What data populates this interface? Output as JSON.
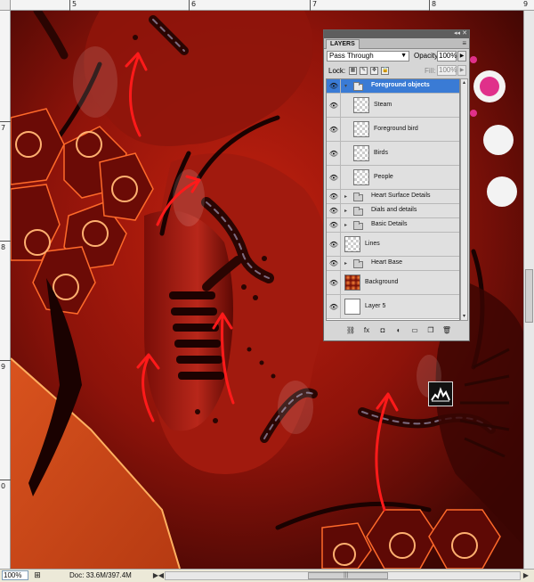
{
  "rulers": {
    "top_numbers": [
      "5",
      "6",
      "7",
      "8",
      "9"
    ],
    "left_numbers": [
      "7",
      "8",
      "9",
      "0"
    ]
  },
  "layers_panel": {
    "tab_label": "LAYERS",
    "minimize_glyph": "◂◂",
    "close_glyph": "✕",
    "menu_glyph": "≡",
    "blend_mode": "Pass Through",
    "opacity_label": "Opacity:",
    "opacity_value": "100%",
    "lock_label": "Lock:",
    "fill_label": "Fill:",
    "fill_value": "100%",
    "eye_glyph": "👁",
    "expanded_glyph": "▾",
    "collapsed_glyph": "▸",
    "scroll_up_glyph": "▴",
    "scroll_down_glyph": "▾",
    "lock_glyphs": [
      "▦",
      "✎",
      "✥",
      "🔒"
    ],
    "layers": [
      {
        "name": "Foreground objects",
        "kind": "group",
        "expanded": true,
        "selected": true
      },
      {
        "name": "Steam",
        "kind": "layer",
        "indent": true
      },
      {
        "name": "Foreground bird",
        "kind": "layer",
        "indent": true
      },
      {
        "name": "Birds",
        "kind": "layer",
        "indent": true
      },
      {
        "name": "People",
        "kind": "layer",
        "indent": true
      },
      {
        "name": "Heart Surface Details",
        "kind": "group",
        "expanded": false
      },
      {
        "name": "Dials and details",
        "kind": "group",
        "expanded": false
      },
      {
        "name": "Basic Details",
        "kind": "group",
        "expanded": false
      },
      {
        "name": "Lines",
        "kind": "layer"
      },
      {
        "name": "Heart Base",
        "kind": "group",
        "expanded": false
      },
      {
        "name": "Background",
        "kind": "image"
      },
      {
        "name": "Layer 5",
        "kind": "white"
      }
    ],
    "bottom_tools": [
      "link-layers",
      "fx",
      "mask",
      "adjustment",
      "new-group",
      "new-layer",
      "delete"
    ],
    "bottom_tool_glyphs": [
      "⛓",
      "fx",
      "◘",
      "◐",
      "▭",
      "❐",
      "🗑"
    ]
  },
  "status_bar": {
    "zoom": "100%",
    "doc_info": "Doc: 33.6M/397.4M",
    "nav_icon_glyph": "⊞",
    "arrow_glyph": "▶",
    "left_arrow_glyph": "◀",
    "right_arrow_glyph": "▶",
    "grip_glyph": "|||"
  },
  "colors": {
    "canvas_dark": "#5a0a06",
    "canvas_red": "#b5190e",
    "glow_orange": "#ff7a2a",
    "arrow_red": "#ff1a1a",
    "selection_blue": "#3a7bd5",
    "pink_dot": "#e0308a"
  }
}
